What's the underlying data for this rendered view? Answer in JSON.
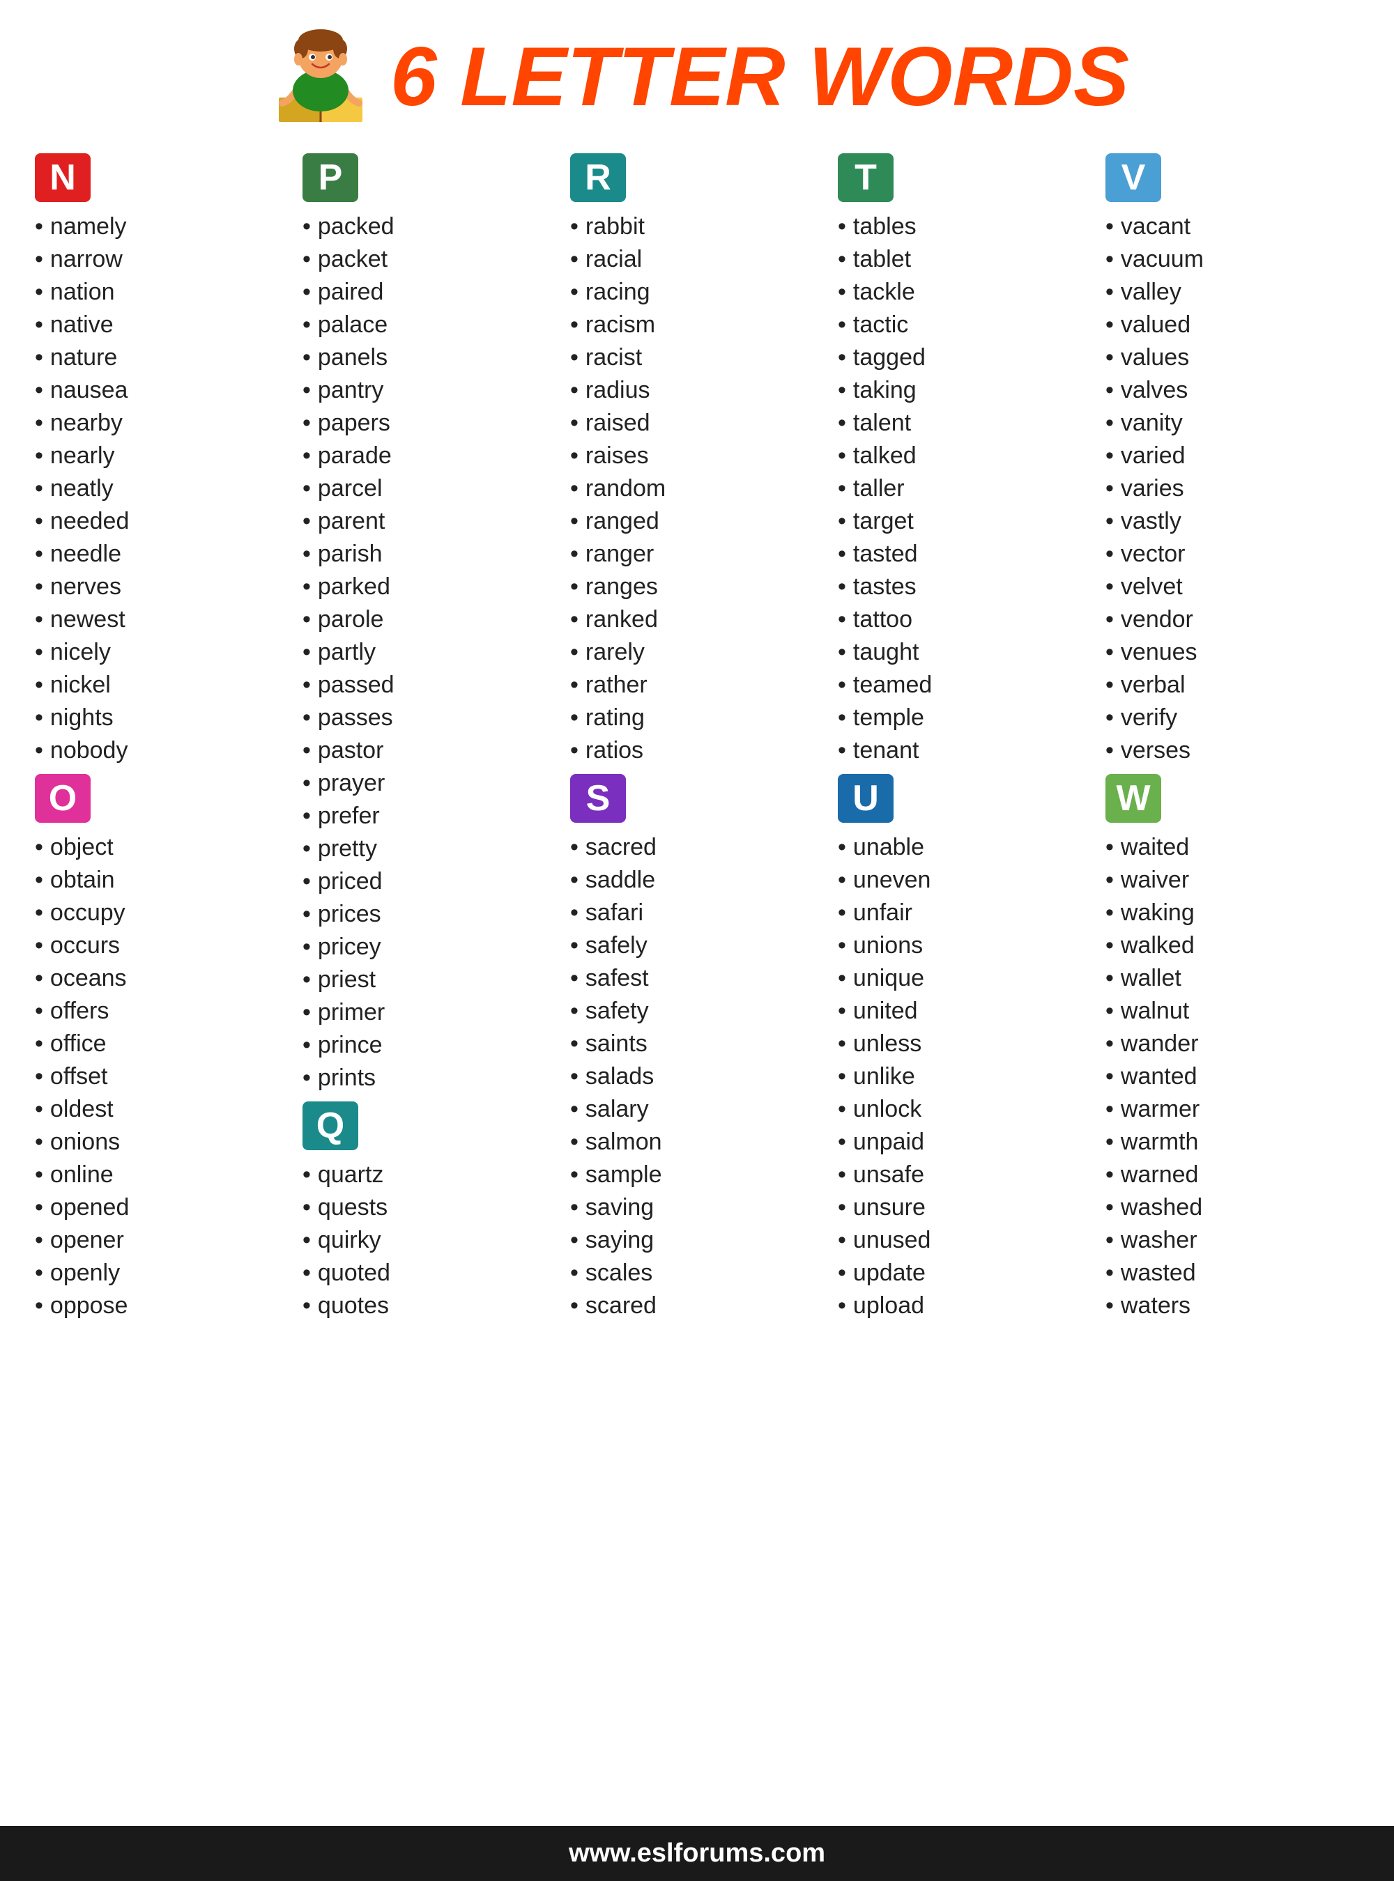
{
  "header": {
    "title": "6 LETTER WORDS"
  },
  "footer": {
    "url": "www.eslforums.com"
  },
  "columns": [
    {
      "letter": "N",
      "color_class": "letter-N",
      "words": [
        "namely",
        "narrow",
        "nation",
        "native",
        "nature",
        "nausea",
        "nearby",
        "nearly",
        "neatly",
        "needed",
        "needle",
        "nerves",
        "newest",
        "nicely",
        "nickel",
        "nights",
        "nobody"
      ]
    },
    {
      "letter": "P",
      "color_class": "letter-P",
      "words": [
        "packed",
        "packet",
        "paired",
        "palace",
        "panels",
        "pantry",
        "papers",
        "parade",
        "parcel",
        "parent",
        "parish",
        "parked",
        "parole",
        "partly",
        "passed",
        "passes",
        "pastor",
        "prayer",
        "prefer",
        "pretty",
        "priced",
        "prices",
        "pricey",
        "priest",
        "primer",
        "prince",
        "prints"
      ]
    },
    {
      "letter": "R",
      "color_class": "letter-R",
      "words": [
        "rabbit",
        "racial",
        "racing",
        "racism",
        "racist",
        "radius",
        "raised",
        "raises",
        "random",
        "ranged",
        "ranger",
        "ranges",
        "ranked",
        "rarely",
        "rather",
        "rating",
        "ratios"
      ]
    },
    {
      "letter": "T",
      "color_class": "letter-T",
      "words": [
        "tables",
        "tablet",
        "tackle",
        "tactic",
        "tagged",
        "taking",
        "talent",
        "talked",
        "taller",
        "target",
        "tasted",
        "tastes",
        "tattoo",
        "taught",
        "teamed",
        "temple",
        "tenant"
      ]
    },
    {
      "letter": "V",
      "color_class": "letter-V",
      "words": [
        "vacant",
        "vacuum",
        "valley",
        "valued",
        "values",
        "valves",
        "vanity",
        "varied",
        "varies",
        "vastly",
        "vector",
        "velvet",
        "vendor",
        "venues",
        "verbal",
        "verify",
        "verses"
      ]
    },
    {
      "letter": "O",
      "color_class": "letter-O",
      "words": [
        "object",
        "obtain",
        "occupy",
        "occurs",
        "oceans",
        "offers",
        "office",
        "offset",
        "oldest",
        "onions",
        "online",
        "opened",
        "opener",
        "openly",
        "oppose"
      ]
    },
    {
      "letter": "Q",
      "color_class": "letter-Q",
      "words": [
        "quartz",
        "quests",
        "quirky",
        "quoted",
        "quotes"
      ]
    },
    {
      "letter": "S",
      "color_class": "letter-S",
      "words": [
        "sacred",
        "saddle",
        "safari",
        "safely",
        "safest",
        "safety",
        "saints",
        "salads",
        "salary",
        "salmon",
        "sample",
        "saving",
        "saying",
        "scales",
        "scared"
      ]
    },
    {
      "letter": "U",
      "color_class": "letter-U",
      "words": [
        "unable",
        "uneven",
        "unfair",
        "unions",
        "unique",
        "united",
        "unless",
        "unlike",
        "unlock",
        "unpaid",
        "unsafe",
        "unsure",
        "unused",
        "update",
        "upload"
      ]
    },
    {
      "letter": "W",
      "color_class": "letter-W",
      "words": [
        "waited",
        "waiver",
        "waking",
        "walked",
        "wallet",
        "walnut",
        "wander",
        "wanted",
        "warmer",
        "warmth",
        "warned",
        "washed",
        "washer",
        "wasted",
        "waters"
      ]
    }
  ]
}
